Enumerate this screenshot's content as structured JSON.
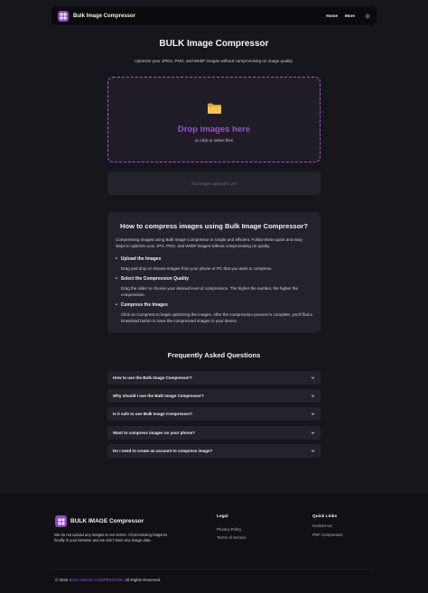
{
  "header": {
    "brand": "Bulk Image Compressor",
    "nav": [
      "Home",
      "More"
    ],
    "theme_icon": "sun-icon"
  },
  "hero": {
    "title": "BULK Image Compressor",
    "subtitle": "Optimize your JPEG, PNG, and WebP images without compromising on image quality."
  },
  "dropzone": {
    "icon": "folder-icon",
    "title": "Drop images here",
    "subtitle": "or click to select files"
  },
  "uploaded": {
    "empty_text": "No images uploaded yet"
  },
  "howto": {
    "title": "How to compress images using Bulk Image Compressor?",
    "intro": "Compressing images using Bulk Image Compressor is simple and efficient. Follow these quick and easy steps to optimize your JPG, PNG, and WebP images without compromising on quality.",
    "steps": [
      {
        "title": "Upload the Images",
        "desc": "Drag and drop or choose images from your phone or PC that you want to compress."
      },
      {
        "title": "Select the Compression Quality",
        "desc": "Drag the slider to choose your desired level of compression. The higher the number, the higher the compression."
      },
      {
        "title": "Compress the Images",
        "desc": "Click on Compress to begin optimizing the images. After the compression process is complete, you'll find a Download button to save the compressed images to your device."
      }
    ]
  },
  "faq": {
    "title": "Frequently Asked Questions",
    "items": [
      "How to use the Bulk Image Compressor?",
      "Why should I use the Bulk Image Compressor?",
      "Is it safe to use Bulk Image Compressor?",
      "Want to compress images on your phone?",
      "Do I need to create an account to compress image?"
    ]
  },
  "footer": {
    "brand": "BULK IMAGE Compressor",
    "description": "We do not upload any images to our server. All processing happens locally in your browser and we don't store any image data.",
    "legal": {
      "title": "Legal",
      "links": [
        "Privacy Policy",
        "Terms of Service"
      ]
    },
    "quick_links": {
      "title": "Quick Links",
      "links": [
        "Contact Us",
        "PDF Compressor"
      ]
    },
    "copyright_prefix": "© 2025 ",
    "copyright_brand": "BULK IMAGE COMPRESSOR",
    "copyright_suffix": ". All Rights Reserved."
  },
  "colors": {
    "accent": "#9d4fd8",
    "background": "#17161c",
    "card": "#24232b"
  }
}
